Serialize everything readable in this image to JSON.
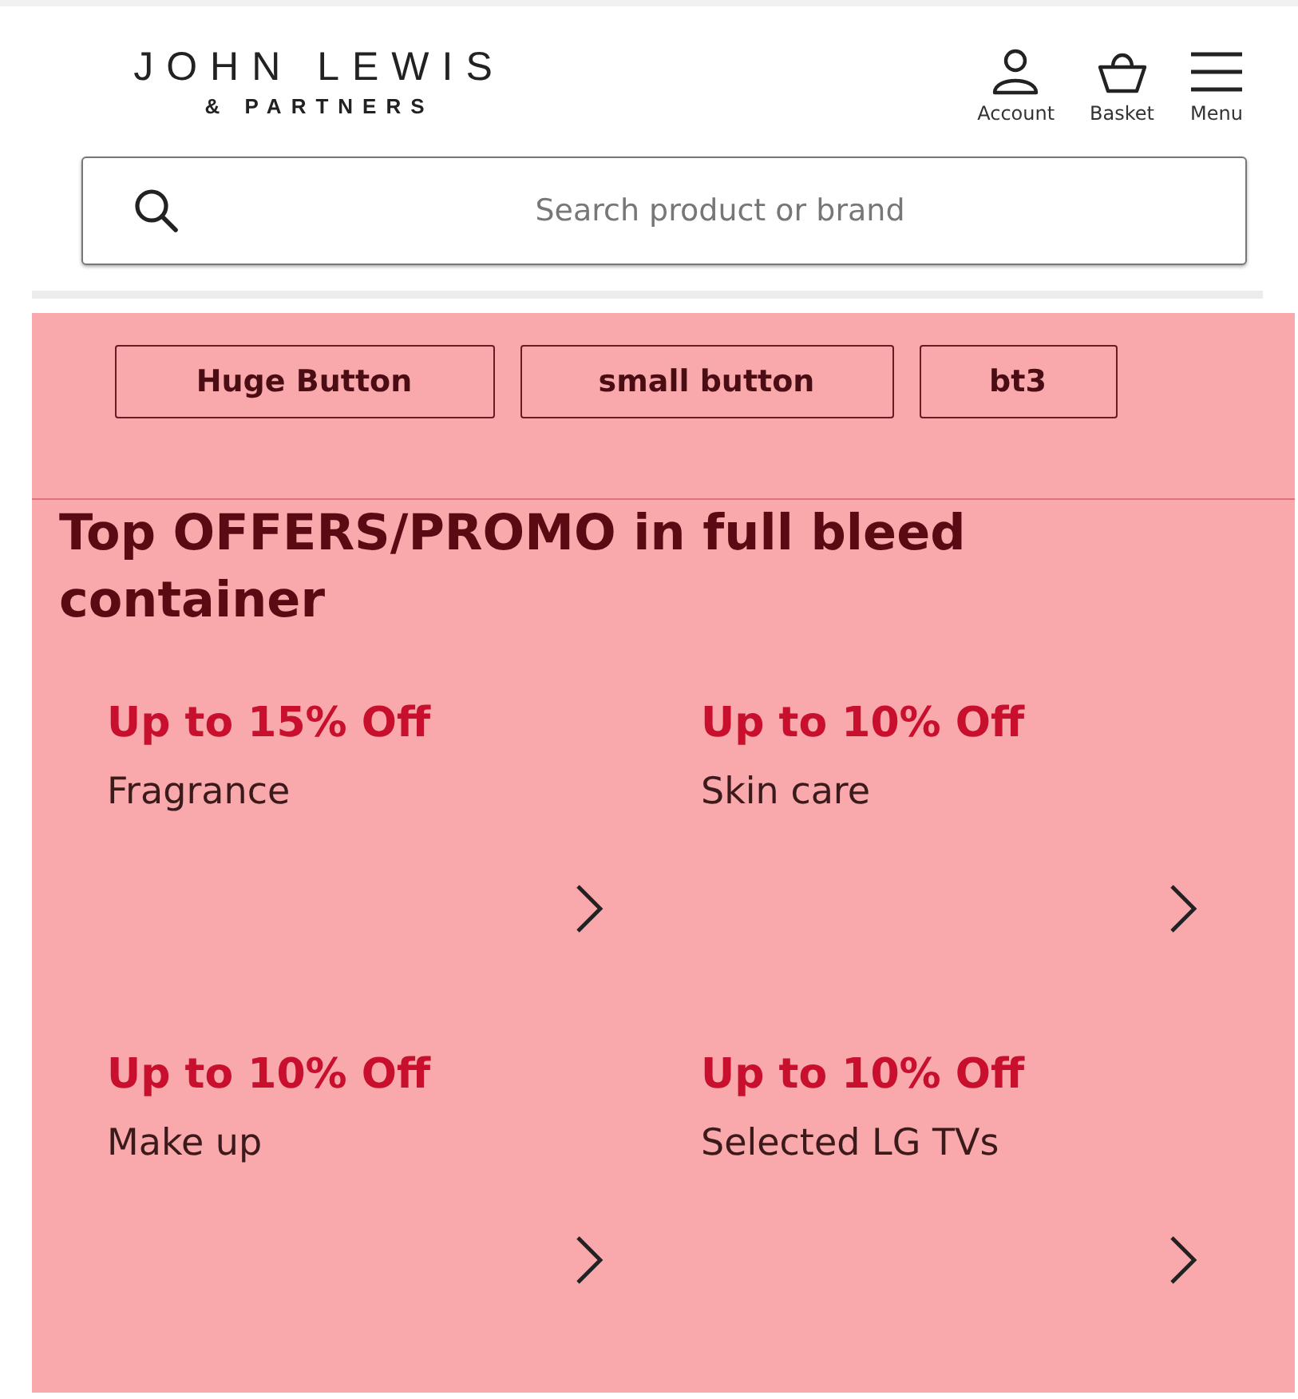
{
  "header": {
    "logo_line_1": "JOHN LEWIS",
    "logo_line_2": "& PARTNERS",
    "actions": [
      {
        "kind": "account",
        "label": "Account"
      },
      {
        "kind": "basket",
        "label": "Basket"
      },
      {
        "kind": "menu",
        "label": "Menu"
      }
    ]
  },
  "search": {
    "placeholder": "Search product or brand"
  },
  "buttons": [
    "Huge Button",
    "small button",
    "bt3"
  ],
  "heading": "Top OFFERS/PROMO in full bleed container",
  "offers": [
    {
      "title": "Up to 15% Off",
      "label": "Fragrance"
    },
    {
      "title": "Up to 10% Off",
      "label": "Skin care"
    },
    {
      "title": "Up to 10% Off",
      "label": "Make up"
    },
    {
      "title": "Up to 10% Off",
      "label": "Selected LG TVs"
    }
  ]
}
